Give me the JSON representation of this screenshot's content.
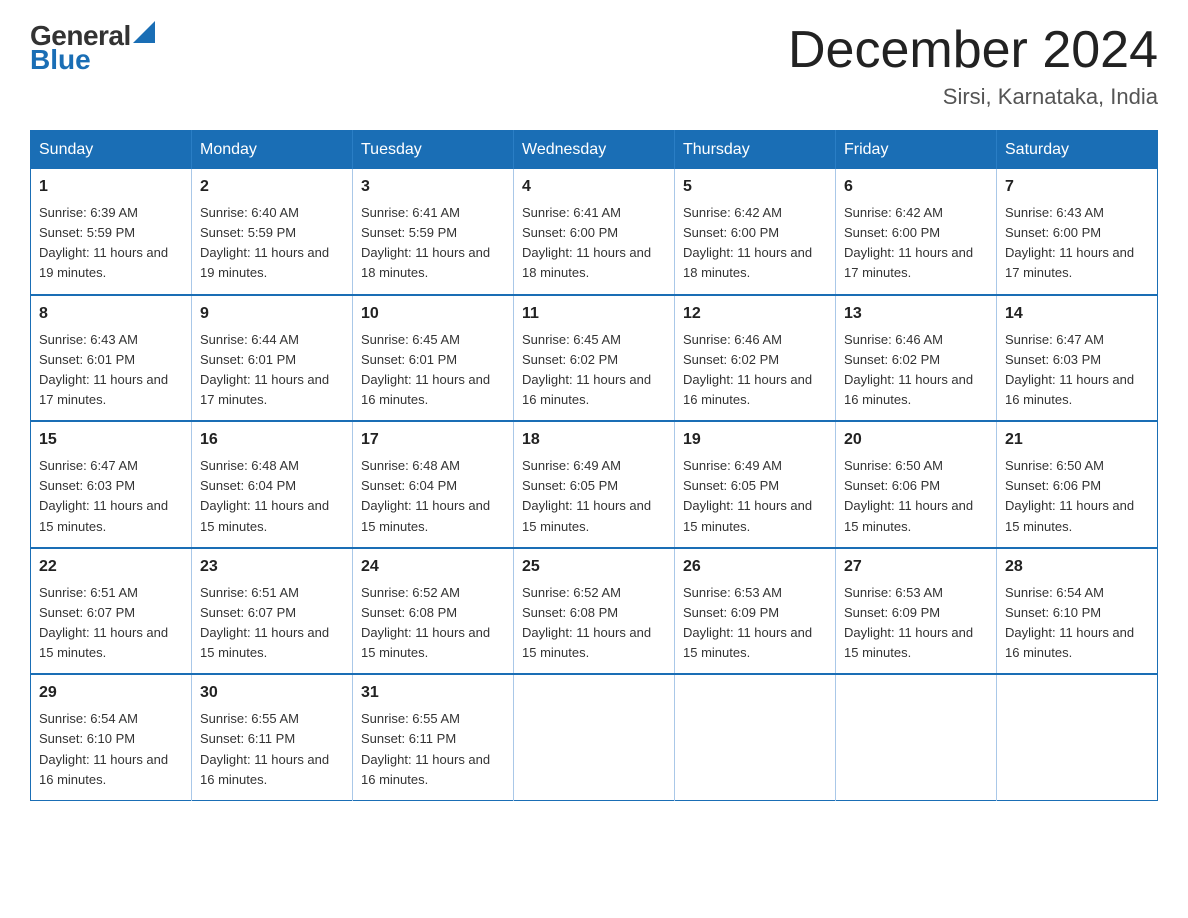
{
  "header": {
    "logo_general": "General",
    "logo_blue": "Blue",
    "month_title": "December 2024",
    "location": "Sirsi, Karnataka, India"
  },
  "days_of_week": [
    "Sunday",
    "Monday",
    "Tuesday",
    "Wednesday",
    "Thursday",
    "Friday",
    "Saturday"
  ],
  "weeks": [
    [
      {
        "day": "1",
        "sunrise": "6:39 AM",
        "sunset": "5:59 PM",
        "daylight": "11 hours and 19 minutes."
      },
      {
        "day": "2",
        "sunrise": "6:40 AM",
        "sunset": "5:59 PM",
        "daylight": "11 hours and 19 minutes."
      },
      {
        "day": "3",
        "sunrise": "6:41 AM",
        "sunset": "5:59 PM",
        "daylight": "11 hours and 18 minutes."
      },
      {
        "day": "4",
        "sunrise": "6:41 AM",
        "sunset": "6:00 PM",
        "daylight": "11 hours and 18 minutes."
      },
      {
        "day": "5",
        "sunrise": "6:42 AM",
        "sunset": "6:00 PM",
        "daylight": "11 hours and 18 minutes."
      },
      {
        "day": "6",
        "sunrise": "6:42 AM",
        "sunset": "6:00 PM",
        "daylight": "11 hours and 17 minutes."
      },
      {
        "day": "7",
        "sunrise": "6:43 AM",
        "sunset": "6:00 PM",
        "daylight": "11 hours and 17 minutes."
      }
    ],
    [
      {
        "day": "8",
        "sunrise": "6:43 AM",
        "sunset": "6:01 PM",
        "daylight": "11 hours and 17 minutes."
      },
      {
        "day": "9",
        "sunrise": "6:44 AM",
        "sunset": "6:01 PM",
        "daylight": "11 hours and 17 minutes."
      },
      {
        "day": "10",
        "sunrise": "6:45 AM",
        "sunset": "6:01 PM",
        "daylight": "11 hours and 16 minutes."
      },
      {
        "day": "11",
        "sunrise": "6:45 AM",
        "sunset": "6:02 PM",
        "daylight": "11 hours and 16 minutes."
      },
      {
        "day": "12",
        "sunrise": "6:46 AM",
        "sunset": "6:02 PM",
        "daylight": "11 hours and 16 minutes."
      },
      {
        "day": "13",
        "sunrise": "6:46 AM",
        "sunset": "6:02 PM",
        "daylight": "11 hours and 16 minutes."
      },
      {
        "day": "14",
        "sunrise": "6:47 AM",
        "sunset": "6:03 PM",
        "daylight": "11 hours and 16 minutes."
      }
    ],
    [
      {
        "day": "15",
        "sunrise": "6:47 AM",
        "sunset": "6:03 PM",
        "daylight": "11 hours and 15 minutes."
      },
      {
        "day": "16",
        "sunrise": "6:48 AM",
        "sunset": "6:04 PM",
        "daylight": "11 hours and 15 minutes."
      },
      {
        "day": "17",
        "sunrise": "6:48 AM",
        "sunset": "6:04 PM",
        "daylight": "11 hours and 15 minutes."
      },
      {
        "day": "18",
        "sunrise": "6:49 AM",
        "sunset": "6:05 PM",
        "daylight": "11 hours and 15 minutes."
      },
      {
        "day": "19",
        "sunrise": "6:49 AM",
        "sunset": "6:05 PM",
        "daylight": "11 hours and 15 minutes."
      },
      {
        "day": "20",
        "sunrise": "6:50 AM",
        "sunset": "6:06 PM",
        "daylight": "11 hours and 15 minutes."
      },
      {
        "day": "21",
        "sunrise": "6:50 AM",
        "sunset": "6:06 PM",
        "daylight": "11 hours and 15 minutes."
      }
    ],
    [
      {
        "day": "22",
        "sunrise": "6:51 AM",
        "sunset": "6:07 PM",
        "daylight": "11 hours and 15 minutes."
      },
      {
        "day": "23",
        "sunrise": "6:51 AM",
        "sunset": "6:07 PM",
        "daylight": "11 hours and 15 minutes."
      },
      {
        "day": "24",
        "sunrise": "6:52 AM",
        "sunset": "6:08 PM",
        "daylight": "11 hours and 15 minutes."
      },
      {
        "day": "25",
        "sunrise": "6:52 AM",
        "sunset": "6:08 PM",
        "daylight": "11 hours and 15 minutes."
      },
      {
        "day": "26",
        "sunrise": "6:53 AM",
        "sunset": "6:09 PM",
        "daylight": "11 hours and 15 minutes."
      },
      {
        "day": "27",
        "sunrise": "6:53 AM",
        "sunset": "6:09 PM",
        "daylight": "11 hours and 15 minutes."
      },
      {
        "day": "28",
        "sunrise": "6:54 AM",
        "sunset": "6:10 PM",
        "daylight": "11 hours and 16 minutes."
      }
    ],
    [
      {
        "day": "29",
        "sunrise": "6:54 AM",
        "sunset": "6:10 PM",
        "daylight": "11 hours and 16 minutes."
      },
      {
        "day": "30",
        "sunrise": "6:55 AM",
        "sunset": "6:11 PM",
        "daylight": "11 hours and 16 minutes."
      },
      {
        "day": "31",
        "sunrise": "6:55 AM",
        "sunset": "6:11 PM",
        "daylight": "11 hours and 16 minutes."
      },
      null,
      null,
      null,
      null
    ]
  ],
  "labels": {
    "sunrise_prefix": "Sunrise: ",
    "sunset_prefix": "Sunset: ",
    "daylight_prefix": "Daylight: "
  }
}
